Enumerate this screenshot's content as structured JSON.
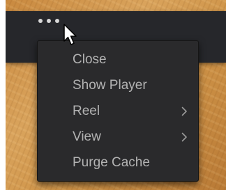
{
  "icons": {
    "more": "more-dots-icon",
    "pointer": "mouse-pointer-icon",
    "submenu": "chevron-right-icon"
  },
  "colors": {
    "menu_bg": "#2a2a2c",
    "menu_text": "#b3b3b3",
    "panel_bg": "#26272b"
  },
  "menu": {
    "items": [
      {
        "label": "Close",
        "has_submenu": false
      },
      {
        "label": "Show Player",
        "has_submenu": false
      },
      {
        "label": "Reel",
        "has_submenu": true
      },
      {
        "label": "View",
        "has_submenu": true
      },
      {
        "label": "Purge Cache",
        "has_submenu": false
      }
    ]
  }
}
